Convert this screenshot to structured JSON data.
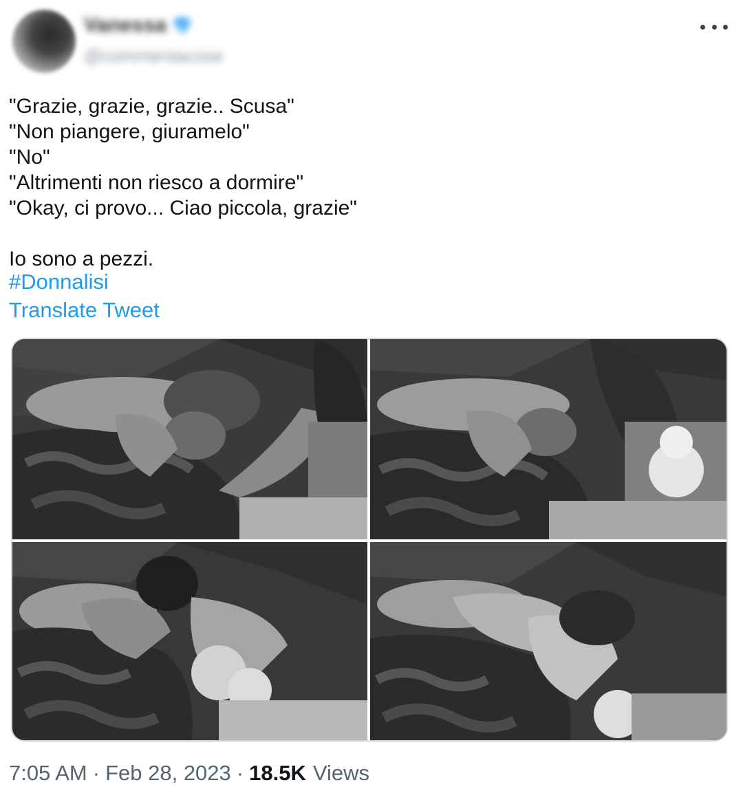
{
  "author": {
    "display_name": "Vanessa",
    "handle": "@commentacose",
    "verified_icon": "verified-badge-icon",
    "avatar_icon": "user-avatar"
  },
  "menu": {
    "more_icon": "more-horizontal-icon"
  },
  "tweet": {
    "lines": [
      "\"Grazie, grazie, grazie.. Scusa\"",
      "\"Non piangere, giuramelo\"",
      "\"No\"",
      "\"Altrimenti non riesco a dormire\"",
      "\"Okay, ci provo... Ciao piccola, grazie\"",
      "",
      "Io sono a pezzi."
    ],
    "hashtag": "#Donnalisi",
    "translate_label": "Translate Tweet"
  },
  "media": {
    "count": 4
  },
  "footer": {
    "time": "7:05 AM",
    "separator": "·",
    "date": "Feb 28, 2023",
    "views_count": "18.5K",
    "views_label": "Views"
  },
  "colors": {
    "link": "#1d9bf0",
    "text": "#0f1419",
    "secondary": "#536471",
    "border": "#cfd9de"
  }
}
